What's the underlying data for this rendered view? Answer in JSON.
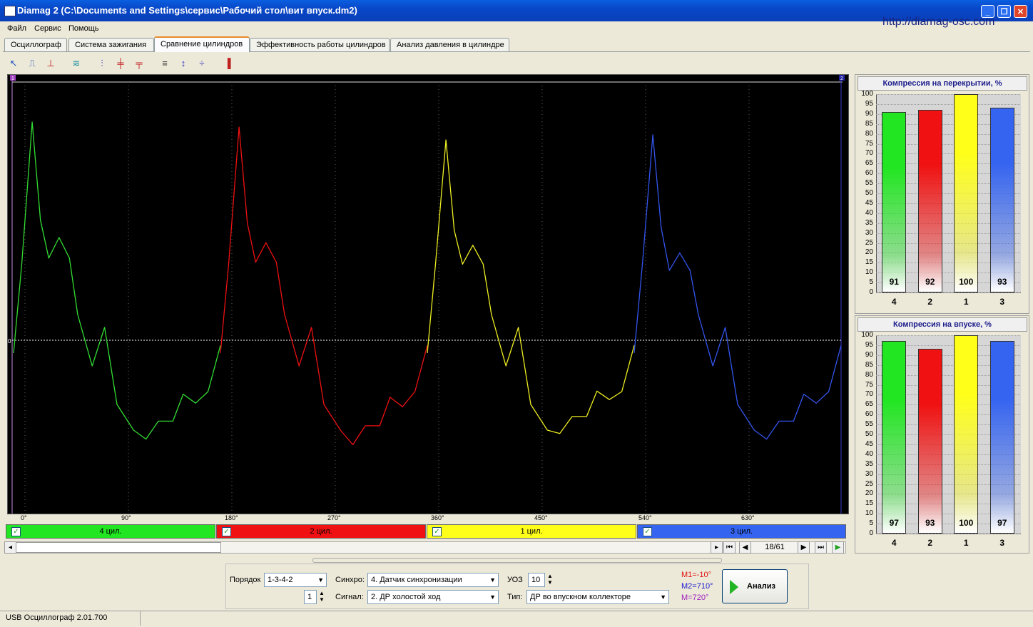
{
  "window": {
    "title": "Diamag 2 (C:\\Documents and Settings\\сервис\\Рабочий стол\\вит впуск.dm2)",
    "url": "http://diamag-osc.com"
  },
  "menu": [
    "Файл",
    "Сервис",
    "Помощь"
  ],
  "tabs": [
    "Осциллограф",
    "Система зажигания",
    "Сравнение цилиндров",
    "Эффективность работы цилиндров",
    "Анализ давления в цилиндре"
  ],
  "active_tab": "Сравнение цилиндров",
  "toolbar_icons": [
    "cursor-icon",
    "edge-rise-icon",
    "edge-fall-icon",
    "signal-icon",
    "peaks-icon",
    "cut-icon",
    "level-icon",
    "lines-icon",
    "stretch-icon",
    "split-icon",
    "bar-chart-icon"
  ],
  "scope": {
    "x_axis_labels": [
      "0°",
      "90°",
      "180°",
      "270°",
      "360°",
      "450°",
      "540°",
      "630°"
    ],
    "zero_label": "0",
    "marker_left": "1",
    "marker_right": "2",
    "segments": [
      {
        "color": "#33dd33",
        "peak": 85,
        "second": 40,
        "min": 35
      },
      {
        "color": "#ee1111",
        "peak": 83,
        "second": 38,
        "min": 37
      },
      {
        "color": "#eeee22",
        "peak": 78,
        "second": 37,
        "min": 33
      },
      {
        "color": "#3355ee",
        "peak": 80,
        "second": 34,
        "min": 35
      }
    ]
  },
  "cylinders": [
    {
      "label": "4 цил.",
      "color": "#21e621",
      "checked": true
    },
    {
      "label": "2 цил.",
      "color": "#f01212",
      "checked": true
    },
    {
      "label": "1 цил.",
      "color": "#ffff1a",
      "checked": true
    },
    {
      "label": "3 цил.",
      "color": "#3564f0",
      "checked": true
    }
  ],
  "navigation": {
    "page": "18/61"
  },
  "controls": {
    "order_label": "Порядок",
    "order_value": "1-3-4-2",
    "order_index": "1",
    "sync_label": "Синхро:",
    "sync_value": "4.  Датчик синхронизации",
    "signal_label": "Сигнал:",
    "signal_value": "2.  ДР холостой ход",
    "uoz_label": "УОЗ",
    "uoz_value": "10",
    "type_label": "Тип:",
    "type_value": "ДР во впускном коллекторе",
    "m1": "M1=-10°",
    "m2": "M2=710°",
    "m": "M=720°",
    "analyze": "Анализ"
  },
  "status": "USB Осциллограф  2.01.700",
  "chart_data": [
    {
      "type": "bar",
      "title": "Компрессия на перекрытии, %",
      "categories": [
        "4",
        "2",
        "1",
        "3"
      ],
      "values": [
        91,
        92,
        100,
        93
      ],
      "colors": [
        "#21e621",
        "#f01212",
        "#ffff1a",
        "#3564f0"
      ],
      "ylim": [
        0,
        100
      ],
      "yticks": [
        0,
        5,
        10,
        15,
        20,
        25,
        30,
        35,
        40,
        45,
        50,
        55,
        60,
        65,
        70,
        75,
        80,
        85,
        90,
        95,
        100
      ]
    },
    {
      "type": "bar",
      "title": "Компрессия на впуске, %",
      "categories": [
        "4",
        "2",
        "1",
        "3"
      ],
      "values": [
        97,
        93,
        100,
        97
      ],
      "colors": [
        "#21e621",
        "#f01212",
        "#ffff1a",
        "#3564f0"
      ],
      "ylim": [
        0,
        100
      ],
      "yticks": [
        0,
        5,
        10,
        15,
        20,
        25,
        30,
        35,
        40,
        45,
        50,
        55,
        60,
        65,
        70,
        75,
        80,
        85,
        90,
        95,
        100
      ]
    }
  ]
}
